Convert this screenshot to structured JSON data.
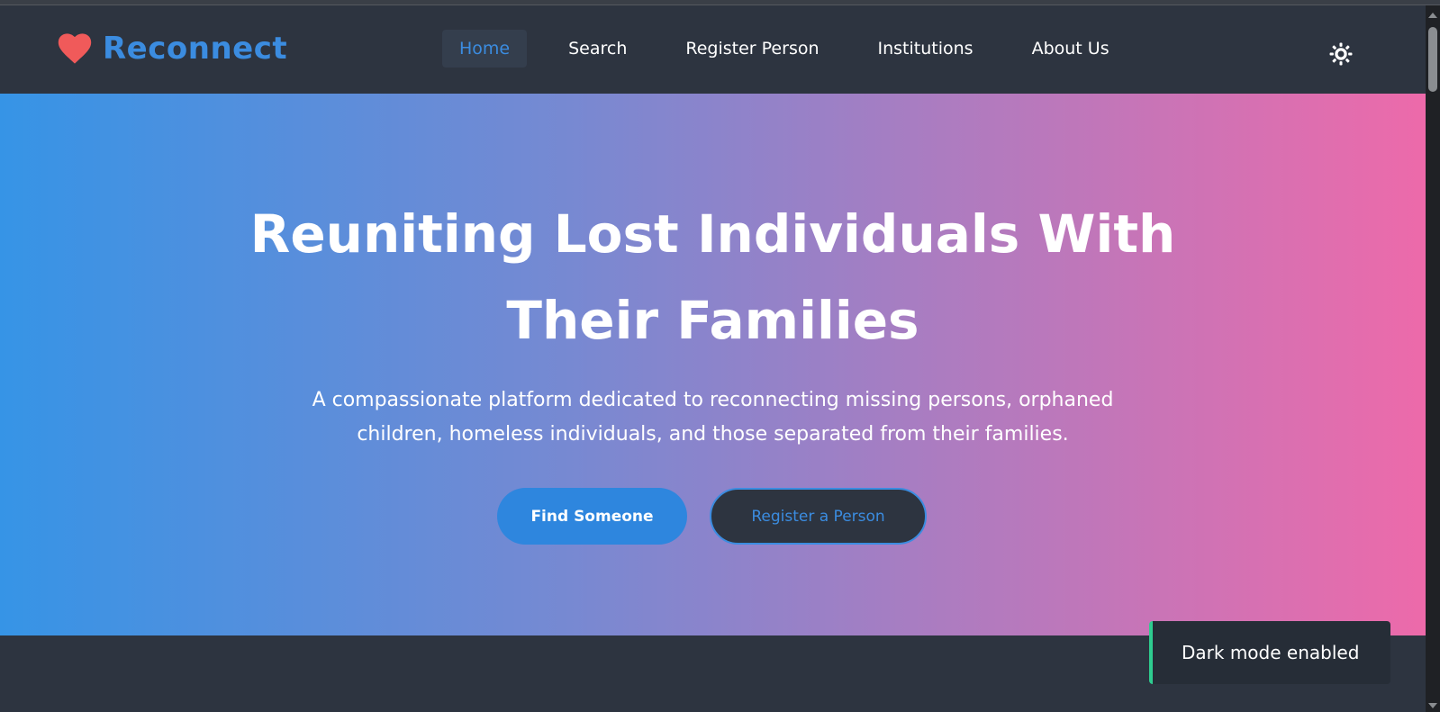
{
  "brand": {
    "name": "Reconnect",
    "icon": "heart-icon",
    "color": "#3b8ce0",
    "icon_color": "#f05a5a"
  },
  "nav": {
    "items": [
      {
        "label": "Home",
        "active": true
      },
      {
        "label": "Search",
        "active": false
      },
      {
        "label": "Register Person",
        "active": false
      },
      {
        "label": "Institutions",
        "active": false
      },
      {
        "label": "About Us",
        "active": false
      }
    ],
    "theme_toggle_icon": "sun-icon"
  },
  "hero": {
    "title_line1": "Reuniting Lost Individuals With",
    "title_line2": "Their Families",
    "subtitle_line1": "A compassionate platform dedicated to reconnecting missing persons, orphaned",
    "subtitle_line2": "children, homeless individuals, and those separated from their families.",
    "primary_button": "Find Someone",
    "secondary_button": "Register a Person",
    "gradient_start": "#3694e6",
    "gradient_end": "#ed6aaa"
  },
  "toast": {
    "message": "Dark mode enabled",
    "accent": "#2ecc8f"
  }
}
